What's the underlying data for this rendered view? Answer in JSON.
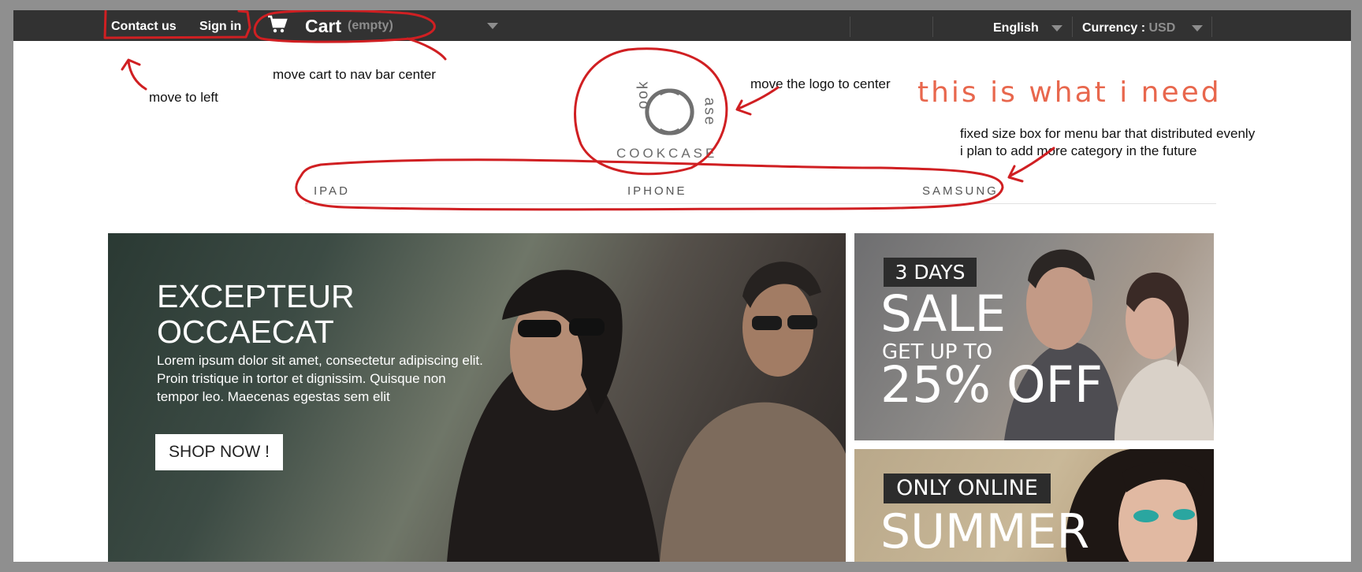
{
  "topbar": {
    "contact_label": "Contact us",
    "signin_label": "Sign in",
    "cart_label": "Cart",
    "cart_status": "(empty)",
    "language_label": "English",
    "currency_label": "Currency :",
    "currency_value": "USD"
  },
  "annotations": {
    "move_left": "move to left",
    "move_cart": "move cart to nav bar center",
    "move_logo": "move the logo to center",
    "what_i_need": "this is what i need",
    "fixed_box_line1": "fixed size box for menu bar that distributed evenly",
    "fixed_box_line2": "i plan to add more category in the future"
  },
  "logo": {
    "text": "COOKCASE",
    "left_word": "ook",
    "right_word": "ase"
  },
  "menu": {
    "categories": [
      "IPAD",
      "IPHONE",
      "SAMSUNG"
    ]
  },
  "hero": {
    "title_line1": "EXCEPTEUR",
    "title_line2": "OCCAECAT",
    "body": "Lorem ipsum dolor sit amet, consectetur adipiscing elit. Proin tristique in tortor et dignissim. Quisque non tempor leo. Maecenas egestas sem elit",
    "button_label": "SHOP NOW !"
  },
  "sale_banner": {
    "tag": "3 DAYS",
    "headline": "SALE",
    "sub": "GET UP TO",
    "discount": "25% OFF"
  },
  "summer_banner": {
    "tag": "ONLY ONLINE",
    "headline": "SUMMER"
  },
  "colors": {
    "topbar": "#323232",
    "annotation_red": "#d01f22",
    "need_text": "#e8674d"
  }
}
